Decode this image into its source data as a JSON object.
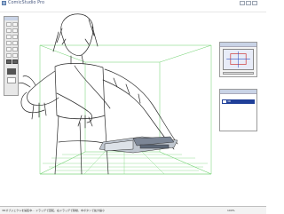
{
  "window": {
    "title": "ComicStudio Pro"
  },
  "menu": {
    "items": [
      "ファイル",
      "編集",
      "表示",
      "ページ",
      "レイヤー",
      "ツール",
      "ウィンドウ",
      "ヘルプ"
    ]
  },
  "tools": {
    "icons": [
      "select-arrow-icon",
      "lasso-icon",
      "pen-icon",
      "pencil-icon",
      "brush-icon",
      "eraser-icon",
      "line-icon",
      "shape-icon",
      "fill-icon",
      "text-icon",
      "hand-icon",
      "zoom-icon"
    ]
  },
  "navigator": {
    "title": "ナビゲーター"
  },
  "layers": {
    "title": "レイヤー",
    "selected_layer": "3D"
  },
  "status": {
    "left_text": "3Dオブジェクトを編集中... ドラッグで回転、右ドラッグで移動、中ボタンで拡大縮小",
    "right_text": "100%"
  }
}
